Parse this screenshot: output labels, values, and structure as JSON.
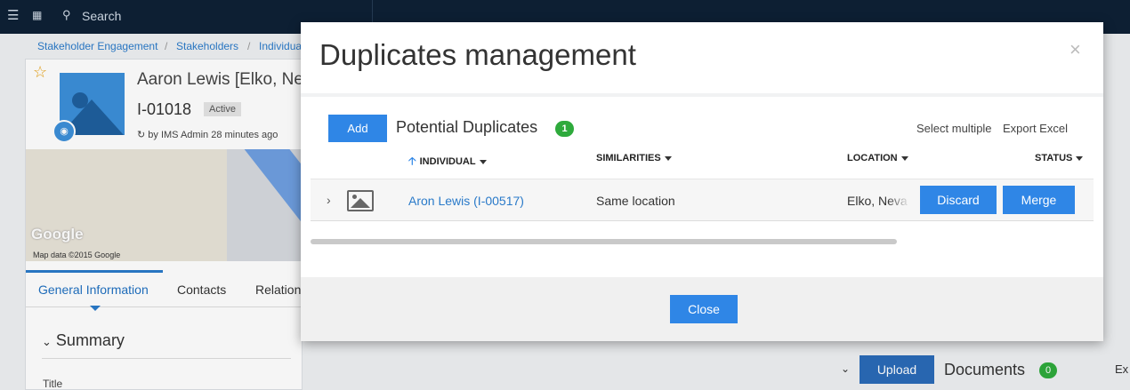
{
  "topbar": {
    "list_icon": "☰",
    "apps_icon": "⋮⋮⋮",
    "search_icon": "🔍",
    "search_label": "Search"
  },
  "breadcrumb": {
    "items": [
      "Stakeholder Engagement",
      "Stakeholders",
      "Individua"
    ],
    "separator": "/"
  },
  "background": {
    "name": "Aaron Lewis [Elko, Ne",
    "code": "I-01018",
    "status": "Active",
    "meta": "by IMS Admin 28 minutes ago",
    "map_logo": "Google",
    "map_data": "Map data ©2015 Google",
    "tabs": [
      "General Information",
      "Contacts",
      "Relation"
    ],
    "summary_heading": "Summary",
    "title_label": "Title",
    "upload_label": "Upload",
    "documents_label": "Documents",
    "documents_count": "0",
    "export_cut": "Ex"
  },
  "modal": {
    "title": "Duplicates management",
    "close_icon": "×",
    "add_label": "Add",
    "section_title": "Potential Duplicates",
    "section_count": "1",
    "select_multiple": "Select multiple",
    "export_excel": "Export Excel",
    "columns": {
      "individual": "INDIVIDUAL",
      "similarities": "SIMILARITIES",
      "location": "LOCATION",
      "status": "STATUS"
    },
    "rows": [
      {
        "individual": "Aron Lewis (I-00517)",
        "similarities": "Same location",
        "location": "Elko, Nevada",
        "discard_label": "Discard",
        "merge_label": "Merge"
      }
    ],
    "close_label": "Close"
  },
  "colors": {
    "accent": "#2f86e6",
    "topbar": "#0d1f33",
    "badge_green": "#2eaa3c",
    "link": "#2a7ac9"
  }
}
